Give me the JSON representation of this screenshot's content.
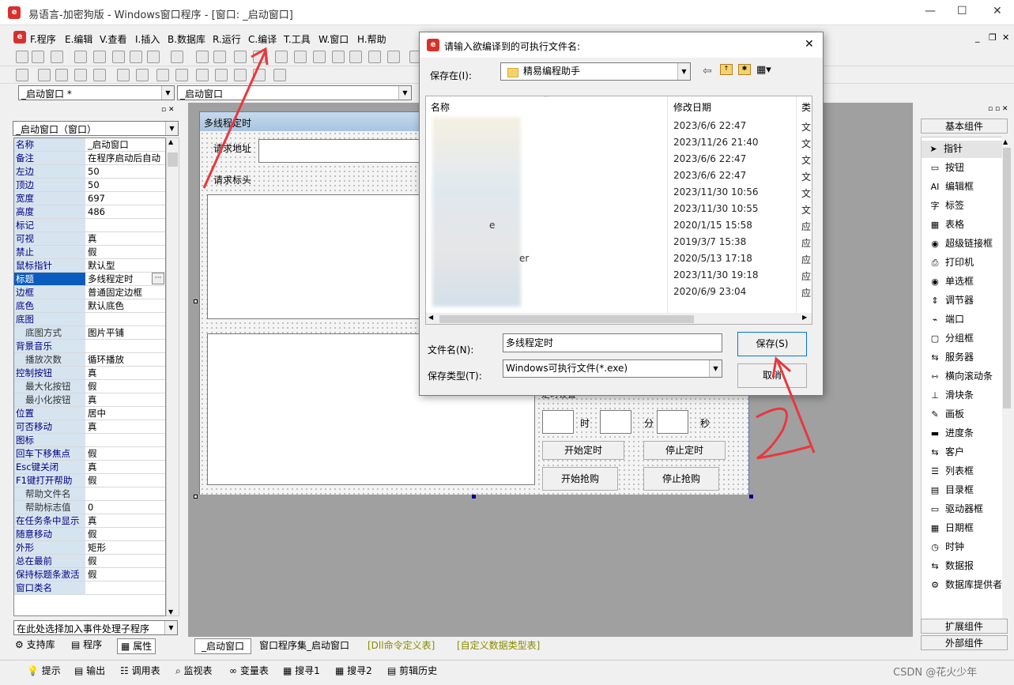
{
  "app": {
    "title": "易语言-加密狗版 - Windows窗口程序 - [窗口: _启动窗口]",
    "logo_text": "e"
  },
  "window_controls": {
    "minimize": "—",
    "maximize": "☐",
    "close": "✕"
  },
  "mdi_controls": {
    "minimize": "_",
    "restore": "❐",
    "close": "✕"
  },
  "menu": [
    "F.程序",
    "E.编辑",
    "V.查看",
    "I.插入",
    "B.数据库",
    "R.运行",
    "C.编译",
    "T.工具",
    "W.窗口",
    "H.帮助"
  ],
  "selectors": {
    "window": "_启动窗口 *",
    "event": "_启动窗口"
  },
  "left_panel": {
    "object_select": "_启动窗口（窗口）",
    "properties": [
      {
        "k": "名称",
        "v": "_启动窗口"
      },
      {
        "k": "备注",
        "v": "在程序启动后自动"
      },
      {
        "k": "左边",
        "v": "50"
      },
      {
        "k": "顶边",
        "v": "50"
      },
      {
        "k": "宽度",
        "v": "697"
      },
      {
        "k": "高度",
        "v": "486"
      },
      {
        "k": "标记",
        "v": ""
      },
      {
        "k": "可视",
        "v": "真"
      },
      {
        "k": "禁止",
        "v": "假"
      },
      {
        "k": "鼠标指针",
        "v": "默认型"
      },
      {
        "k": "标题",
        "v": "多线程定时",
        "selected": true
      },
      {
        "k": "边框",
        "v": "普通固定边框"
      },
      {
        "k": "底色",
        "v": "默认底色"
      },
      {
        "k": "底图",
        "v": ""
      },
      {
        "k": "底图方式",
        "v": "图片平铺",
        "sub": true
      },
      {
        "k": "背景音乐",
        "v": ""
      },
      {
        "k": "播放次数",
        "v": "循环播放",
        "sub": true
      },
      {
        "k": "控制按钮",
        "v": "真"
      },
      {
        "k": "最大化按钮",
        "v": "假",
        "sub": true
      },
      {
        "k": "最小化按钮",
        "v": "真",
        "sub": true
      },
      {
        "k": "位置",
        "v": "居中"
      },
      {
        "k": "可否移动",
        "v": "真"
      },
      {
        "k": "图标",
        "v": ""
      },
      {
        "k": "回车下移焦点",
        "v": "假"
      },
      {
        "k": "Esc键关闭",
        "v": "真"
      },
      {
        "k": "F1键打开帮助",
        "v": "假"
      },
      {
        "k": "帮助文件名",
        "v": "",
        "sub": true
      },
      {
        "k": "帮助标志值",
        "v": "0",
        "sub": true
      },
      {
        "k": "在任务条中显示",
        "v": "真"
      },
      {
        "k": "随意移动",
        "v": "假"
      },
      {
        "k": "外形",
        "v": "矩形"
      },
      {
        "k": "总在最前",
        "v": "假"
      },
      {
        "k": "保持标题条激活",
        "v": "假"
      },
      {
        "k": "窗口类名",
        "v": ""
      }
    ],
    "event_select": "在此处选择加入事件处理子程序",
    "tabs": [
      "支持库",
      "程序",
      "属性"
    ]
  },
  "form": {
    "title": "多线程定时",
    "label_url": "请求地址",
    "label_header": "请求标头",
    "group_title": "定时设置",
    "hour": "时",
    "minute": "分",
    "second": "秒",
    "btn_start_timer": "开始定时",
    "btn_stop_timer": "停止定时",
    "btn_start_grab": "开始抢购",
    "btn_stop_grab": "停止抢购"
  },
  "dialog": {
    "title": "请输入欲编译到的可执行文件名:",
    "save_in_label": "保存在(I):",
    "save_in_value": "精易编程助手",
    "columns": {
      "name": "名称",
      "date": "修改日期",
      "type": "类"
    },
    "files": [
      {
        "date": "2023/6/6 22:47",
        "type": "文"
      },
      {
        "date": "2023/11/26 21:40",
        "type": "文"
      },
      {
        "date": "2023/6/6 22:47",
        "type": "文"
      },
      {
        "date": "2023/6/6 22:47",
        "type": "文"
      },
      {
        "date": "2023/11/30 10:56",
        "type": "文"
      },
      {
        "date": "2023/11/30 10:55",
        "type": "文"
      },
      {
        "date": "2020/1/15 15:58",
        "type": "应"
      },
      {
        "date": "2019/3/7 15:38",
        "type": "应"
      },
      {
        "date": "2020/5/13 17:18",
        "type": "应"
      },
      {
        "date": "2023/11/30 19:18",
        "type": "应"
      },
      {
        "date": "2020/6/9 23:04",
        "type": "应"
      }
    ],
    "name_fragments": {
      "e": "e",
      "er": "er"
    },
    "filename_label": "文件名(N):",
    "filename_value": "多线程定时",
    "filetype_label": "保存类型(T):",
    "filetype_value": "Windows可执行文件(*.exe)",
    "save_button": "保存(S)",
    "cancel_button": "取消",
    "close": "✕"
  },
  "annotation": {
    "text": "2",
    "color": "#e8383d"
  },
  "right_panel": {
    "header": "基本组件",
    "components": [
      {
        "label": "指针",
        "icon": "pointer-icon",
        "glyph": "➤"
      },
      {
        "label": "按钮",
        "icon": "button-icon",
        "glyph": "▭"
      },
      {
        "label": "编辑框",
        "icon": "editbox-icon",
        "glyph": "AI"
      },
      {
        "label": "标签",
        "icon": "label-icon",
        "glyph": "字"
      },
      {
        "label": "表格",
        "icon": "table-icon",
        "glyph": "▦"
      },
      {
        "label": "超级链接框",
        "icon": "hyperlink-icon",
        "glyph": "◉"
      },
      {
        "label": "打印机",
        "icon": "printer-icon",
        "glyph": "⎙"
      },
      {
        "label": "单选框",
        "icon": "radio-icon",
        "glyph": "◉"
      },
      {
        "label": "调节器",
        "icon": "spinner-icon",
        "glyph": "⇕"
      },
      {
        "label": "端口",
        "icon": "port-icon",
        "glyph": "⌁"
      },
      {
        "label": "分组框",
        "icon": "groupbox-icon",
        "glyph": "▢"
      },
      {
        "label": "服务器",
        "icon": "server-icon",
        "glyph": "⇆"
      },
      {
        "label": "横向滚动条",
        "icon": "hscroll-icon",
        "glyph": "⇿"
      },
      {
        "label": "滑块条",
        "icon": "slider-icon",
        "glyph": "⊥"
      },
      {
        "label": "画板",
        "icon": "canvas-icon",
        "glyph": "✎"
      },
      {
        "label": "进度条",
        "icon": "progress-icon",
        "glyph": "▬"
      },
      {
        "label": "客户",
        "icon": "client-icon",
        "glyph": "⇆"
      },
      {
        "label": "列表框",
        "icon": "listbox-icon",
        "glyph": "☰"
      },
      {
        "label": "目录框",
        "icon": "dirbox-icon",
        "glyph": "▤"
      },
      {
        "label": "驱动器框",
        "icon": "drivebox-icon",
        "glyph": "▭"
      },
      {
        "label": "日期框",
        "icon": "datebox-icon",
        "glyph": "▦"
      },
      {
        "label": "时钟",
        "icon": "clock-icon",
        "glyph": "◷"
      },
      {
        "label": "数据报",
        "icon": "datagram-icon",
        "glyph": "⇆"
      },
      {
        "label": "数据库提供者",
        "icon": "dbprovider-icon",
        "glyph": "⚙"
      }
    ],
    "ext": "扩展组件",
    "external": "外部组件"
  },
  "bottom_tabs": [
    "_启动窗口",
    "窗口程序集_启动窗口",
    "[Dll命令定义表]",
    "[自定义数据类型表]"
  ],
  "status_items": [
    "提示",
    "输出",
    "调用表",
    "监视表",
    "变量表",
    "搜寻1",
    "搜寻2",
    "剪辑历史"
  ],
  "watermark": "CSDN @花火少年"
}
